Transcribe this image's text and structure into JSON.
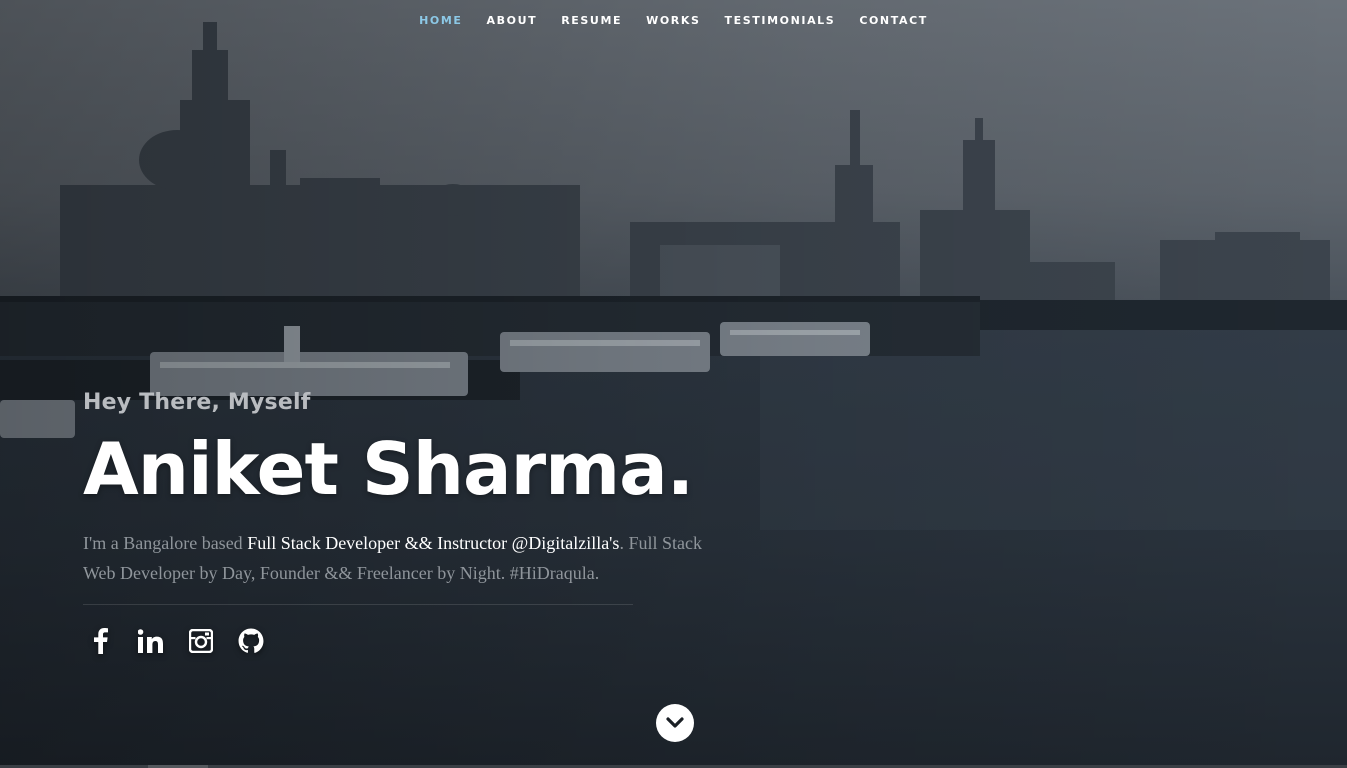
{
  "nav": {
    "items": [
      {
        "label": "HOME",
        "active": true
      },
      {
        "label": "ABOUT",
        "active": false
      },
      {
        "label": "RESUME",
        "active": false
      },
      {
        "label": "WORKS",
        "active": false
      },
      {
        "label": "TESTIMONIALS",
        "active": false
      },
      {
        "label": "CONTACT",
        "active": false
      }
    ],
    "active_color": "#8cc8e6"
  },
  "intro": {
    "greeting": "Hey There, Myself",
    "name": "Aniket Sharma.",
    "desc_prefix": "I'm a Bangalore based ",
    "desc_highlight": "Full Stack Developer && Instructor @Digitalzilla's",
    "desc_suffix": ". Full Stack Web Developer by Day, Founder && Freelancer by Night. #HiDraqula."
  },
  "social": {
    "icons": [
      "facebook-icon",
      "linkedin-icon",
      "instagram-icon",
      "github-icon"
    ]
  },
  "scroll": {
    "icon": "chevron-down-icon"
  }
}
